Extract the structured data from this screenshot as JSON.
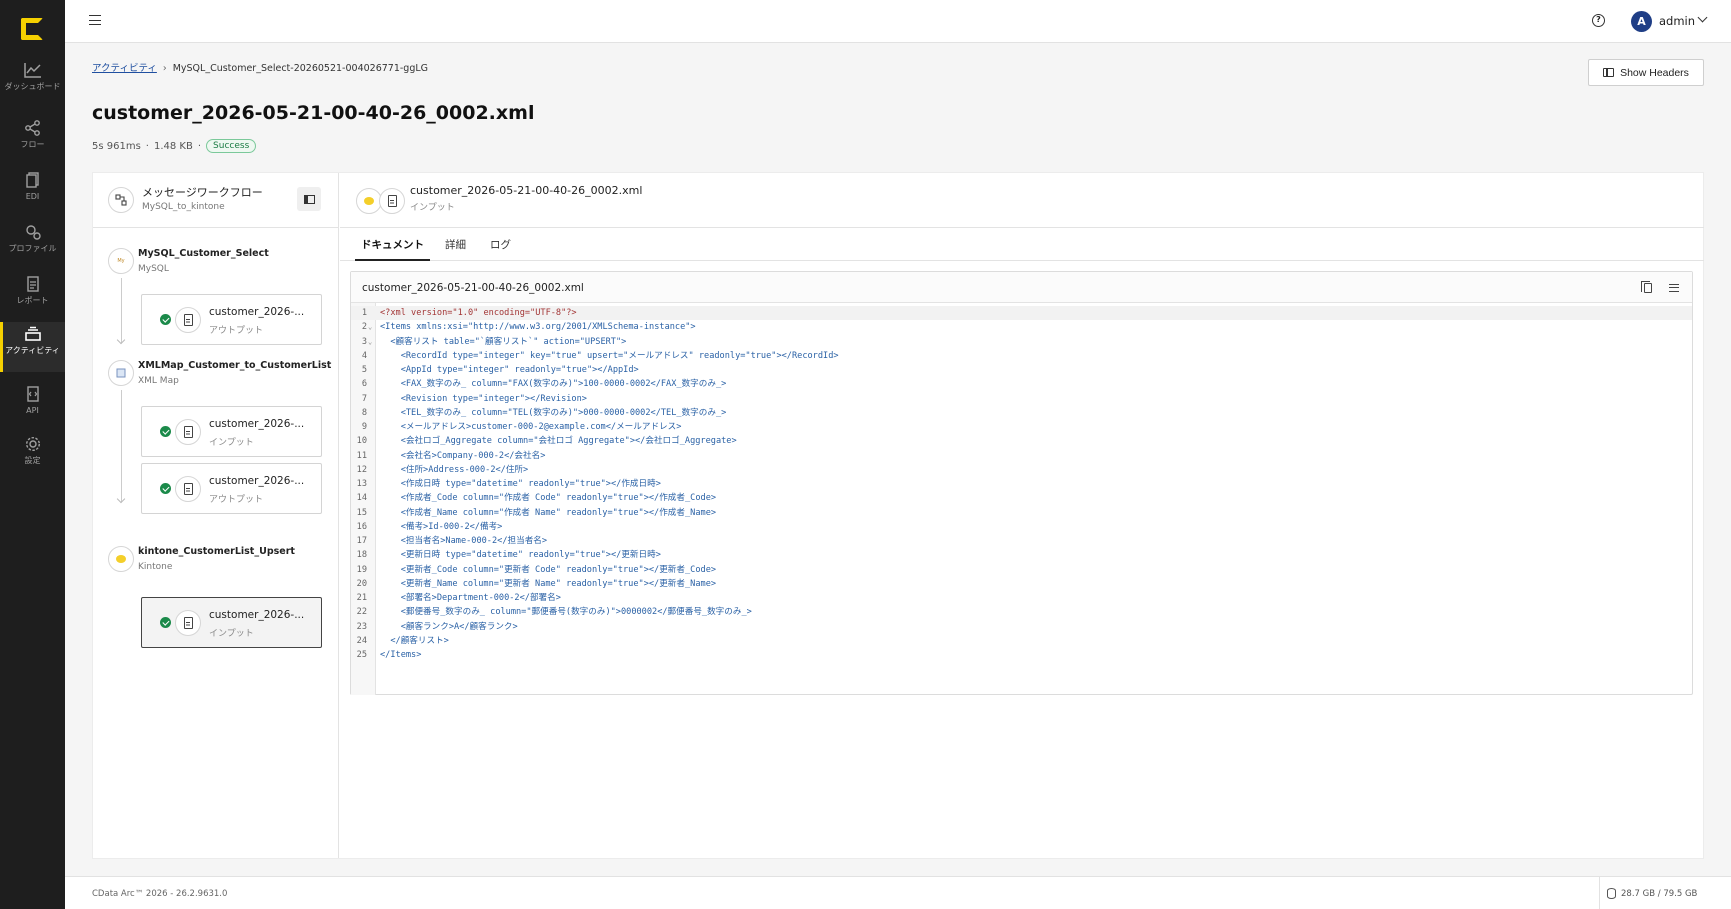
{
  "sidebar": {
    "items": [
      {
        "label": "ダッシュボード",
        "icon": "chart-line-icon"
      },
      {
        "label": "フロー",
        "icon": "flow-share-icon"
      },
      {
        "label": "EDI",
        "icon": "edi-document-icon"
      },
      {
        "label": "プロファイル",
        "icon": "profile-gears-icon"
      },
      {
        "label": "レポート",
        "icon": "report-document-icon"
      },
      {
        "label": "アクティビティ",
        "icon": "activity-stack-icon",
        "active": true
      },
      {
        "label": "API",
        "icon": "api-document-icon"
      },
      {
        "label": "設定",
        "icon": "settings-gear-icon"
      }
    ]
  },
  "topbar": {
    "user": "admin",
    "avatar_initial": "A"
  },
  "breadcrumb": {
    "root": "アクティビティ",
    "current": "MySQL_Customer_Select-20260521-004026771-ggLG"
  },
  "header": {
    "show_headers_label": "Show Headers",
    "title": "customer_2026-05-21-00-40-26_0002.xml",
    "duration": "5s 961ms",
    "size": "1.48 KB",
    "status": "Success"
  },
  "workflow": {
    "title": "メッセージワークフロー",
    "name": "MySQL_to_kintone",
    "nodes": [
      {
        "name": "MySQL_Customer_Select",
        "type": "MySQL",
        "files": [
          {
            "name": "customer_2026-...",
            "role": "アウトプット"
          }
        ]
      },
      {
        "name": "XMLMap_Customer_to_CustomerList",
        "type": "XML Map",
        "files": [
          {
            "name": "customer_2026-...",
            "role": "インプット"
          },
          {
            "name": "customer_2026-...",
            "role": "アウトプット"
          }
        ]
      },
      {
        "name": "kintone_CustomerList_Upsert",
        "type": "Kintone",
        "files": [
          {
            "name": "customer_2026-...",
            "role": "インプット",
            "selected": true
          }
        ]
      }
    ]
  },
  "document": {
    "title": "customer_2026-05-21-00-40-26_0002.xml",
    "role": "インプット",
    "tabs": [
      "ドキュメント",
      "詳細",
      "ログ"
    ],
    "active_tab": "ドキュメント",
    "editor_filename": "customer_2026-05-21-00-40-26_0002.xml",
    "lines": [
      "<?xml version=\"1.0\" encoding=\"UTF-8\"?>",
      "<Items xmlns:xsi=\"http://www.w3.org/2001/XMLSchema-instance\">",
      "  <顧客リスト table=\"`顧客リスト`\" action=\"UPSERT\">",
      "    <RecordId type=\"integer\" key=\"true\" upsert=\"メールアドレス\" readonly=\"true\"></RecordId>",
      "    <AppId type=\"integer\" readonly=\"true\"></AppId>",
      "    <FAX_数字のみ_ column=\"FAX(数字のみ)\">100-0000-0002</FAX_数字のみ_>",
      "    <Revision type=\"integer\"></Revision>",
      "    <TEL_数字のみ_ column=\"TEL(数字のみ)\">000-0000-0002</TEL_数字のみ_>",
      "    <メールアドレス>customer-000-2@example.com</メールアドレス>",
      "    <会社ロゴ_Aggregate column=\"会社ロゴ Aggregate\"></会社ロゴ_Aggregate>",
      "    <会社名>Company-000-2</会社名>",
      "    <住所>Address-000-2</住所>",
      "    <作成日時 type=\"datetime\" readonly=\"true\"></作成日時>",
      "    <作成者_Code column=\"作成者 Code\" readonly=\"true\"></作成者_Code>",
      "    <作成者_Name column=\"作成者 Name\" readonly=\"true\"></作成者_Name>",
      "    <備考>Id-000-2</備考>",
      "    <担当者名>Name-000-2</担当者名>",
      "    <更新日時 type=\"datetime\" readonly=\"true\"></更新日時>",
      "    <更新者_Code column=\"更新者 Code\" readonly=\"true\"></更新者_Code>",
      "    <更新者_Name column=\"更新者 Name\" readonly=\"true\"></更新者_Name>",
      "    <部署名>Department-000-2</部署名>",
      "    <郵便番号_数字のみ_ column=\"郵便番号(数字のみ)\">0000002</郵便番号_数字のみ_>",
      "    <顧客ランク>A</顧客ランク>",
      "  </顧客リスト>",
      "</Items>"
    ]
  },
  "footer": {
    "version": "CData Arc™ 2026 - 26.2.9631.0",
    "storage": "28.7 GB / 79.5 GB"
  },
  "colors": {
    "sidebar_bg": "#1e1e1e",
    "accent": "#f5d000",
    "success": "#1b8a4a",
    "avatar": "#1f3e86"
  }
}
